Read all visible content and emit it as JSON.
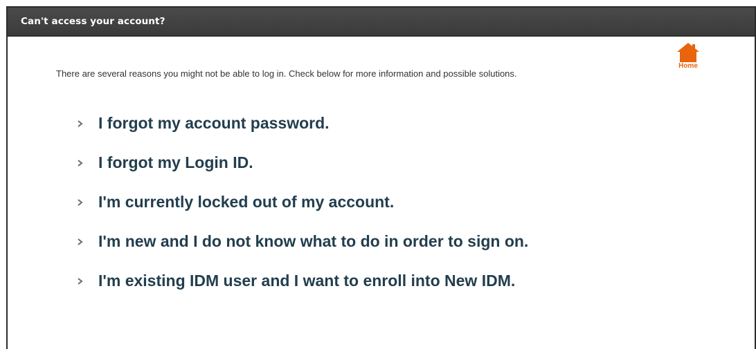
{
  "panel": {
    "title": "Can't access your account?"
  },
  "home": {
    "label": "Home",
    "icon": "house-icon",
    "color": "#e8650e"
  },
  "intro": "There are several reasons you might not be able to log in. Check below for more information and possible solutions.",
  "options": [
    {
      "label": "I forgot my account password.",
      "icon": "chevron-right-icon"
    },
    {
      "label": "I forgot my Login ID.",
      "icon": "chevron-right-icon"
    },
    {
      "label": "I'm currently locked out of my account.",
      "icon": "chevron-right-icon"
    },
    {
      "label": "I'm new and I do not know what to do in order to sign on.",
      "icon": "chevron-right-icon"
    },
    {
      "label": "I'm existing IDM user and I want to enroll into New IDM.",
      "icon": "chevron-right-icon"
    }
  ],
  "colors": {
    "header_bg": "#404040",
    "header_text": "#ffffff",
    "link_text": "#223e4d",
    "accent": "#e8650e"
  }
}
